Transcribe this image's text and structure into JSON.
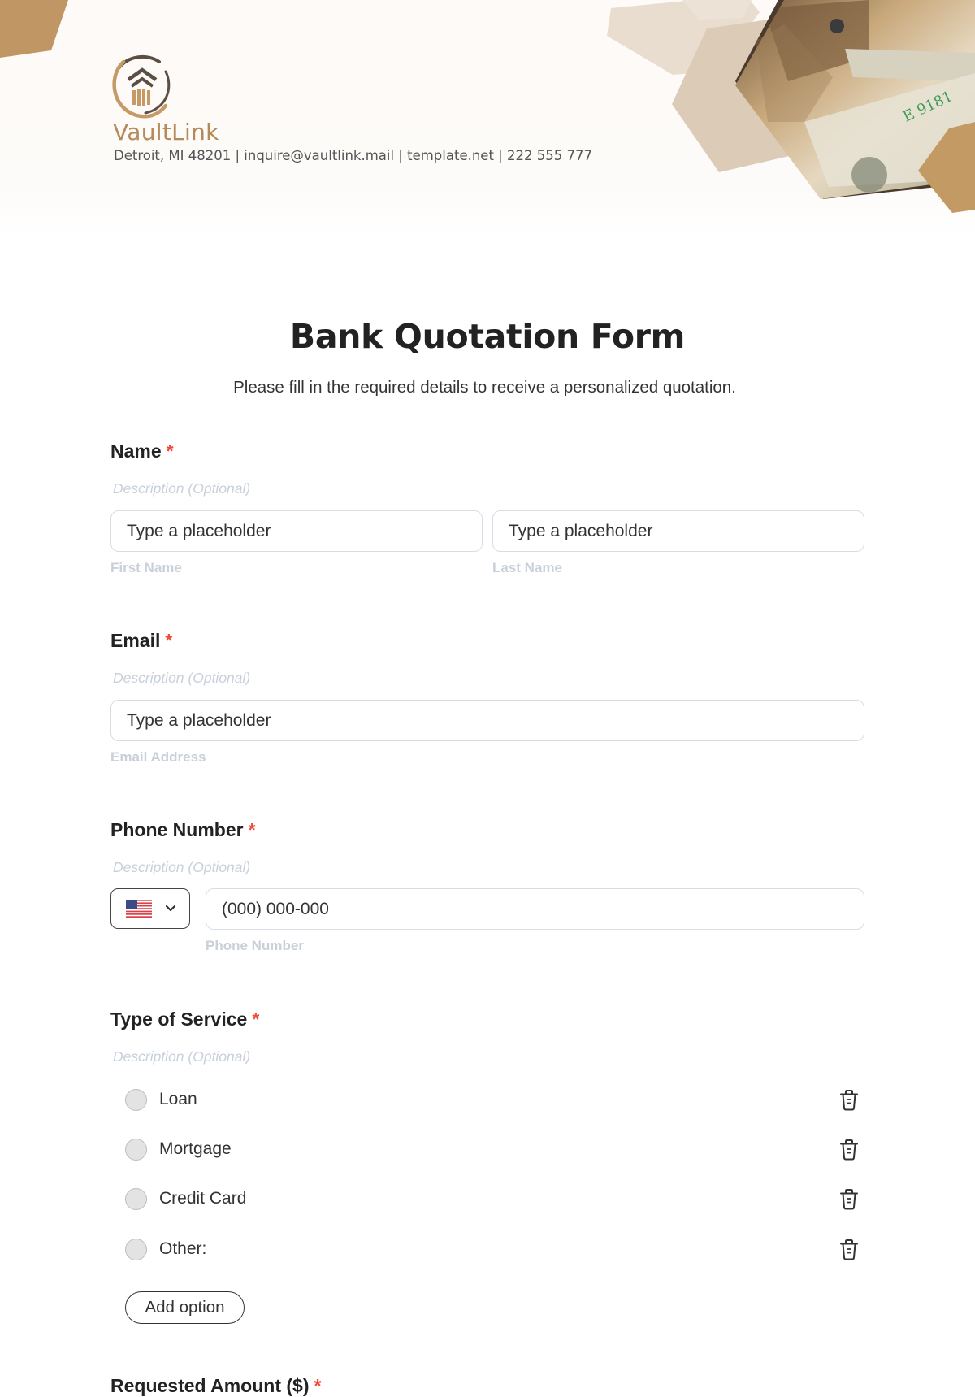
{
  "header": {
    "brand_name": "VaultLink",
    "contact_line": "Detroit, MI 48201 | inquire@vaultlink.mail | template.net | 222 555 777",
    "colors": {
      "brand_gold": "#b58a5a",
      "brand_dark": "#4a3a2c",
      "hex_light": "#e9ddd0",
      "hex_mid": "#dccbb7"
    }
  },
  "form": {
    "title": "Bank Quotation Form",
    "subtitle": "Please fill in the required details to receive a personalized quotation.",
    "required_marker": "*",
    "required_color": "#ef4b3a",
    "fields": {
      "name": {
        "label": "Name",
        "description": "Description (Optional)",
        "first_placeholder": "Type a placeholder",
        "first_sublabel": "First Name",
        "last_placeholder": "Type a placeholder",
        "last_sublabel": "Last Name"
      },
      "email": {
        "label": "Email",
        "description": "Description (Optional)",
        "placeholder": "Type a placeholder",
        "sublabel": "Email Address"
      },
      "phone": {
        "label": "Phone Number",
        "description": "Description (Optional)",
        "country_icon": "us-flag-icon",
        "placeholder": "(000) 000-000",
        "sublabel": "Phone Number"
      },
      "service": {
        "label": "Type of Service",
        "description": "Description (Optional)",
        "options": [
          {
            "label": "Loan",
            "selected": false
          },
          {
            "label": "Mortgage",
            "selected": false
          },
          {
            "label": "Credit Card",
            "selected": false
          },
          {
            "label": "Other:",
            "selected": false
          }
        ],
        "delete_icon": "trash-icon",
        "add_option_label": "Add option"
      },
      "next_partial": {
        "label": "Requested Amount ($)"
      }
    }
  }
}
